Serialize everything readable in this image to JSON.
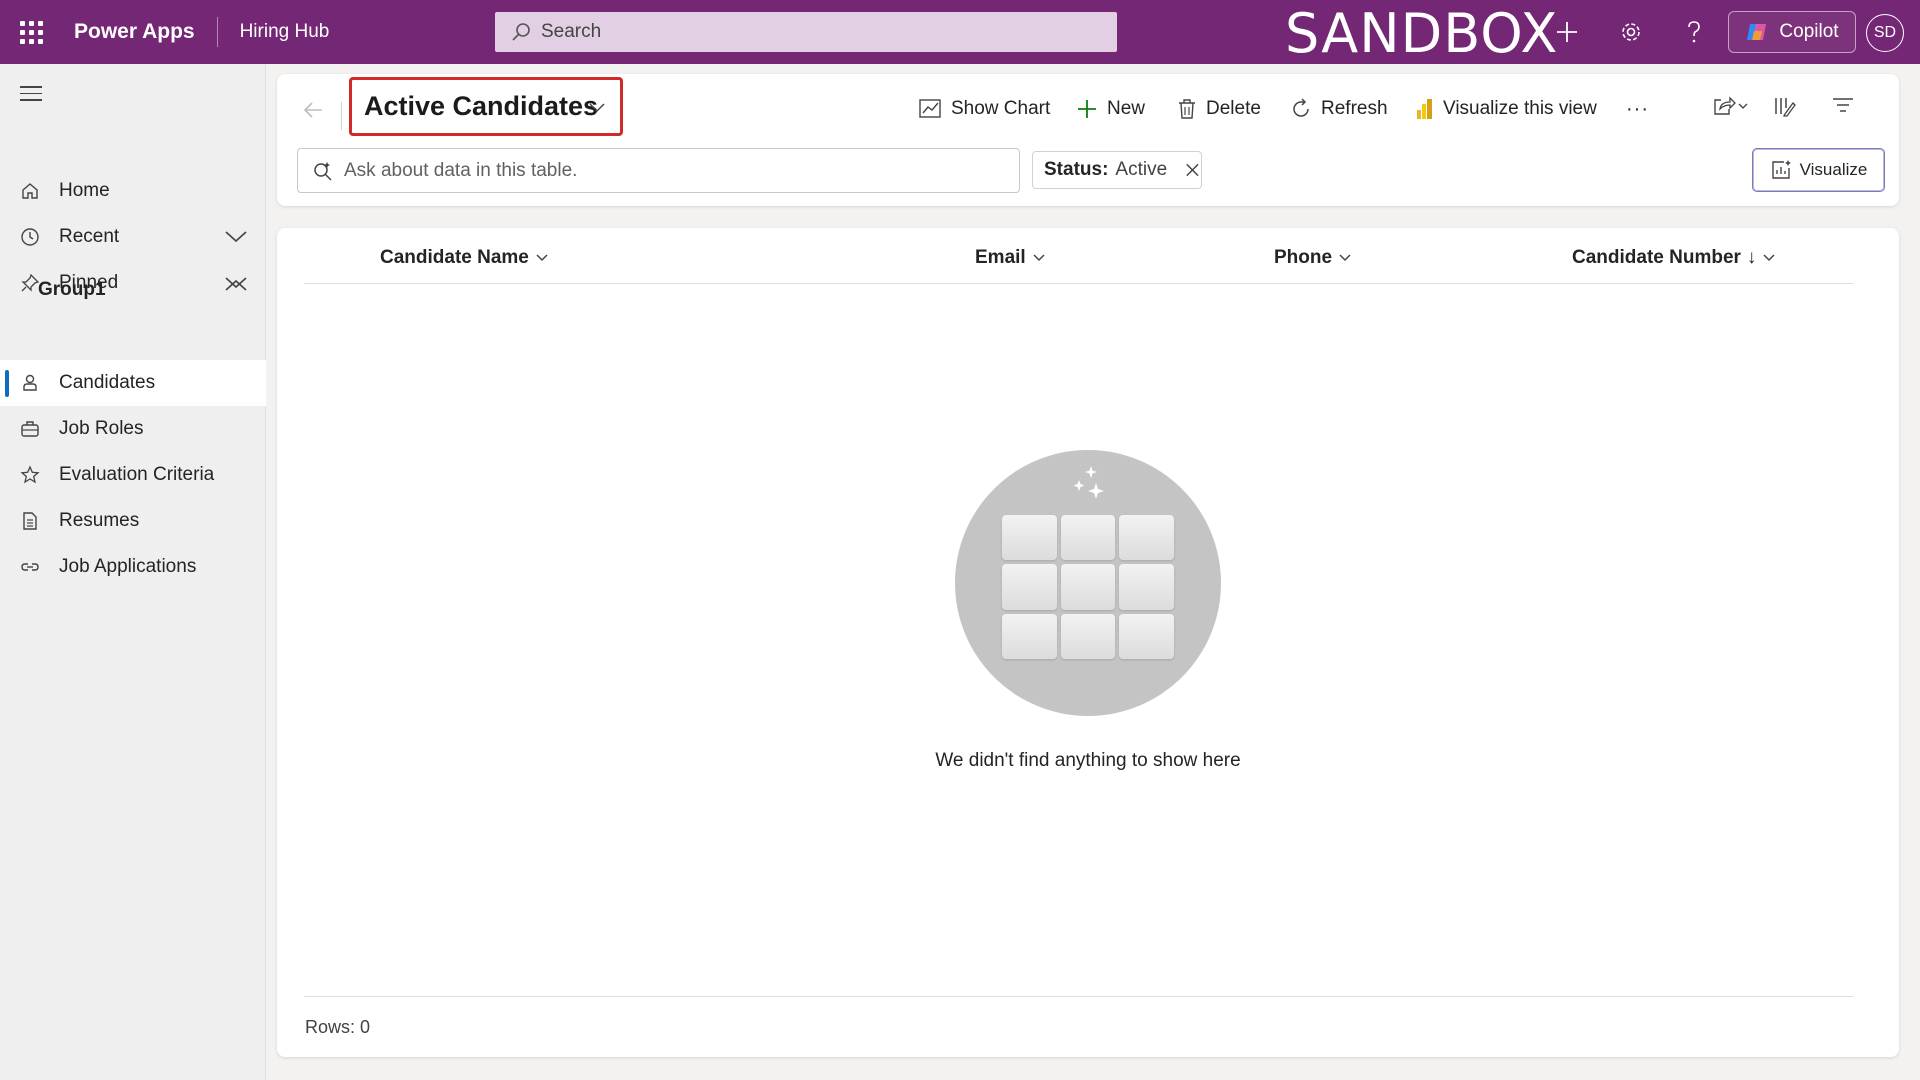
{
  "topbar": {
    "app_name": "Power Apps",
    "app_subtitle": "Hiring Hub",
    "search_placeholder": "Search",
    "environment_label": "SANDBOX",
    "copilot_label": "Copilot",
    "user_initials": "SD",
    "icons": [
      "waffle-icon",
      "search-icon",
      "plus-icon",
      "gear-icon",
      "help-icon",
      "copilot-icon"
    ]
  },
  "sidebar": {
    "items": [
      {
        "label": "Home",
        "icon": "home-icon"
      },
      {
        "label": "Recent",
        "icon": "clock-icon"
      },
      {
        "label": "Pinned",
        "icon": "pin-icon"
      }
    ],
    "group_label": "Group1",
    "group_items": [
      {
        "label": "Candidates",
        "icon": "person-icon",
        "active": true
      },
      {
        "label": "Job Roles",
        "icon": "briefcase-icon"
      },
      {
        "label": "Evaluation Criteria",
        "icon": "star-icon"
      },
      {
        "label": "Resumes",
        "icon": "document-icon"
      },
      {
        "label": "Job Applications",
        "icon": "link-icon"
      }
    ]
  },
  "header": {
    "view_title": "Active Candidates",
    "commands": {
      "show_chart": "Show Chart",
      "new": "New",
      "delete": "Delete",
      "refresh": "Refresh",
      "visualize_view": "Visualize this view",
      "more": "···"
    },
    "ask_placeholder": "Ask about data in this table.",
    "filter": {
      "key": "Status:",
      "value": "Active"
    },
    "visualize_label": "Visualize"
  },
  "grid": {
    "columns": [
      {
        "label": "Candidate Name",
        "sort": ""
      },
      {
        "label": "Email",
        "sort": ""
      },
      {
        "label": "Phone",
        "sort": ""
      },
      {
        "label": "Candidate Number",
        "sort": "↓"
      }
    ],
    "empty_message": "We didn't find anything to show here",
    "rows_label": "Rows: 0"
  },
  "colors": {
    "topbar": "#742774",
    "accent": "#0f6cbd",
    "highlight_border": "#d12a2a"
  }
}
